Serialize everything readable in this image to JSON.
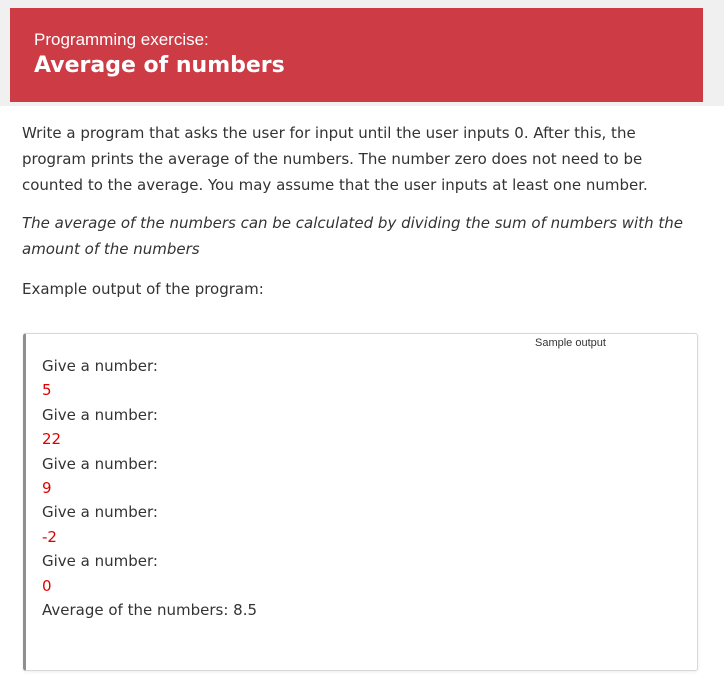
{
  "header": {
    "kicker": "Programming exercise:",
    "title": "Average of numbers",
    "color": "#cd3b45"
  },
  "body": {
    "description": "Write a program that asks the user for input until the user inputs 0. After this, the program prints the average of the numbers. The number zero does not need to be counted to the average. You may assume that the user inputs at least one number.",
    "hint": "The average of the numbers can be calculated by dividing the sum of numbers with the amount of the numbers",
    "example_label": "Example output of the program:"
  },
  "sample": {
    "tag": "Sample output",
    "lines": [
      {
        "text": "Give a number:",
        "kind": "out"
      },
      {
        "text": "5",
        "kind": "in"
      },
      {
        "text": "Give a number:",
        "kind": "out"
      },
      {
        "text": "22",
        "kind": "in"
      },
      {
        "text": "Give a number:",
        "kind": "out"
      },
      {
        "text": "9",
        "kind": "in"
      },
      {
        "text": "Give a number:",
        "kind": "out"
      },
      {
        "text": "-2",
        "kind": "in"
      },
      {
        "text": "Give a number:",
        "kind": "out"
      },
      {
        "text": "0",
        "kind": "in"
      },
      {
        "text": "Average of the numbers: 8.5",
        "kind": "out"
      }
    ],
    "input_color": "#e00000"
  }
}
